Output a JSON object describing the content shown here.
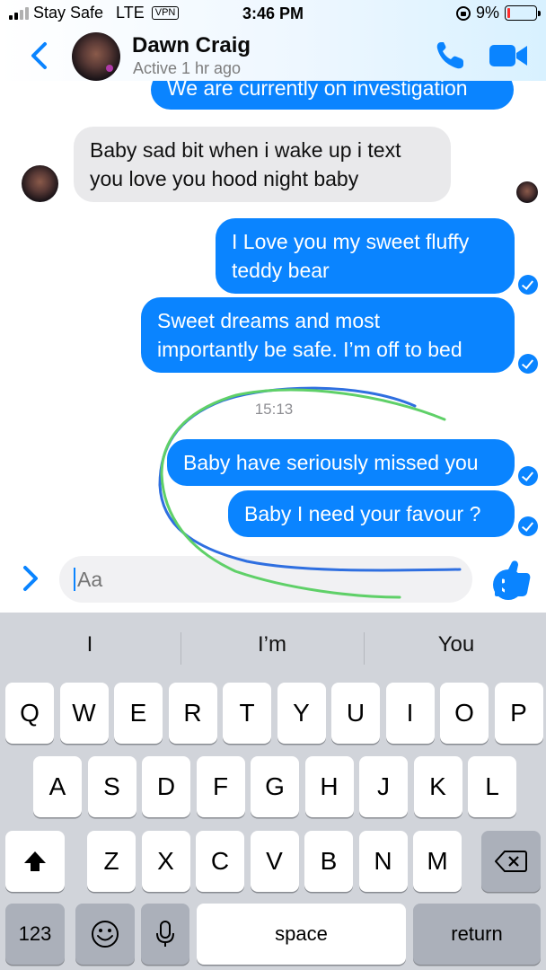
{
  "status_bar": {
    "carrier": "Stay Safe",
    "network": "LTE",
    "vpn": "VPN",
    "time": "3:46 PM",
    "battery": "9%",
    "battery_level": 0.09,
    "battery_color": "#ff2d2d"
  },
  "header": {
    "contact_name": "Dawn Craig",
    "contact_status": "Active 1 hr ago",
    "icons": [
      "chevron-left-icon",
      "avatar",
      "phone-icon",
      "video-camera-icon"
    ]
  },
  "messages": [
    {
      "direction": "outgoing",
      "lines": [
        "We are currently on investigation"
      ]
    },
    {
      "direction": "incoming",
      "lines": [
        "Baby sad bit when i wake up i text",
        "you love you hood night baby"
      ]
    },
    {
      "direction": "outgoing",
      "lines": [
        "I Love you my sweet fluffy",
        "teddy bear"
      ]
    },
    {
      "direction": "outgoing",
      "lines": [
        "Sweet dreams and most",
        "importantly be safe. I’m off to bed"
      ]
    },
    {
      "direction": "outgoing",
      "lines": [
        "Baby have seriously missed you"
      ]
    },
    {
      "direction": "outgoing",
      "lines": [
        "Baby I need your favour ?"
      ]
    }
  ],
  "timestamp": "15:13",
  "composer": {
    "placeholder": "Aa",
    "icons": [
      "chevron-right-icon",
      "smiley-icon",
      "thumbs-up-icon"
    ]
  },
  "keyboard": {
    "suggestions": [
      "I",
      "I’m",
      "You"
    ],
    "row1": [
      "Q",
      "W",
      "E",
      "R",
      "T",
      "Y",
      "U",
      "I",
      "O",
      "P"
    ],
    "row2": [
      "A",
      "S",
      "D",
      "F",
      "G",
      "H",
      "J",
      "K",
      "L"
    ],
    "row3": [
      "Z",
      "X",
      "C",
      "V",
      "B",
      "N",
      "M"
    ],
    "numbers_key": "123",
    "space_key": "space",
    "return_key": "return",
    "icons": [
      "shift-icon",
      "backspace-icon",
      "emoji-icon",
      "microphone-icon"
    ]
  },
  "colors": {
    "accent": "#0a84ff",
    "incoming_bubble": "#e9e9eb",
    "keyboard_bg": "#d1d4da",
    "annotation_blue": "#2f6fe0",
    "annotation_green": "#5fd068"
  }
}
